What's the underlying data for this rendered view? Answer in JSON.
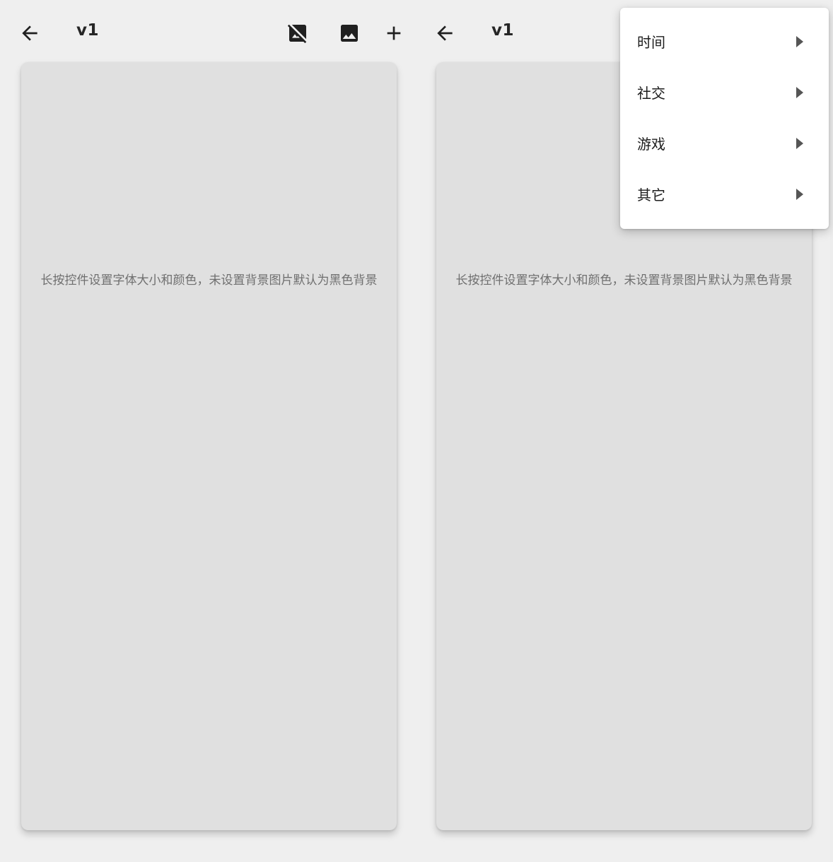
{
  "left_screen": {
    "title": "v1",
    "back_icon": "arrow-back-icon",
    "toolbar_icons": [
      "hide-image-icon",
      "image-icon",
      "add-icon"
    ],
    "hint": "长按控件设置字体大小和颜色，未设置背景图片默认为黑色背景"
  },
  "right_screen": {
    "title": "v1",
    "back_icon": "arrow-back-icon",
    "hint": "长按控件设置字体大小和颜色，未设置背景图片默认为黑色背景"
  },
  "menu": {
    "items": [
      {
        "label": "时间"
      },
      {
        "label": "社交"
      },
      {
        "label": "游戏"
      },
      {
        "label": "其它"
      }
    ]
  }
}
